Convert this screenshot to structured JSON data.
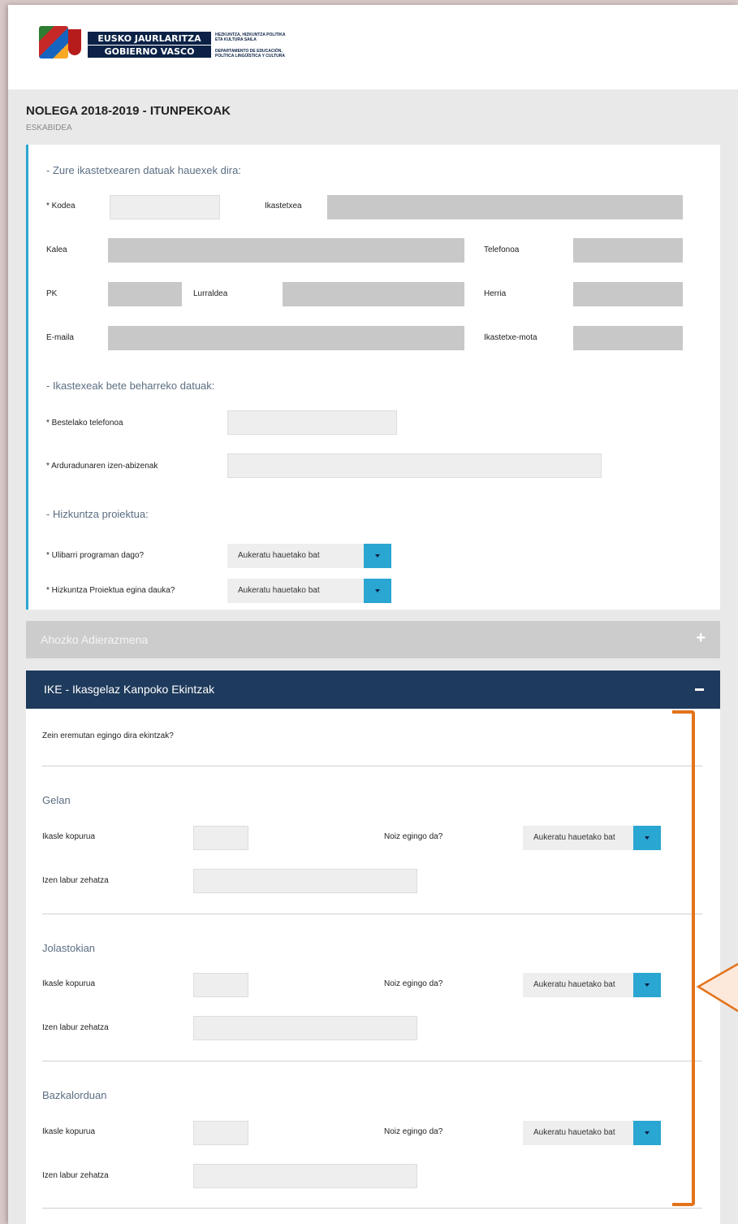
{
  "header": {
    "logo_line1": "EUSKO JAURLARITZA",
    "logo_line2": "GOBIERNO VASCO",
    "dept_eu_1": "HEZKUNTZA, HIZKUNTZA POLITIKA",
    "dept_eu_2": "ETA KULTURA SAILA",
    "dept_es_1": "DEPARTAMENTO DE EDUCACIÓN,",
    "dept_es_2": "POLÍTICA LINGÜÍSTICA Y CULTURA"
  },
  "page": {
    "title": "NOLEGA 2018-2019 - ITUNPEKOAK",
    "subtitle": "ESKABIDEA"
  },
  "school": {
    "heading": "- Zure ikastetxearen datuak hauexek dira:",
    "kodea_label": "* Kodea",
    "ikastetxea_label": "Ikastetxea",
    "kalea_label": "Kalea",
    "telefonoa_label": "Telefonoa",
    "pk_label": "PK",
    "lurraldea_label": "Lurraldea",
    "herria_label": "Herria",
    "emaila_label": "E-maila",
    "mota_label": "Ikastetxe-mota"
  },
  "fill": {
    "heading": "- Ikastexeak bete beharreko datuak:",
    "phone_label": "* Bestelako telefonoa",
    "resp_label": "* Arduradunaren izen-abizenak"
  },
  "lang": {
    "heading": "- Hizkuntza proiektua:",
    "ulibarri_label": "* Ulibarri programan dago?",
    "proiektua_label": "* Hizkuntza Proiektua egina dauka?",
    "select_placeholder": "Aukeratu hauetako bat"
  },
  "ahozko": {
    "title": "Ahozko Adierazmena"
  },
  "ike": {
    "title": "IKE - Ikasgelaz Kanpoko Ekintzak",
    "question": "Zein eremutan egingo dira ekintzak?",
    "sections": [
      {
        "name": "Gelan"
      },
      {
        "name": "Jolastokian"
      },
      {
        "name": "Bazkalorduan"
      }
    ],
    "count_label": "Ikasle kopurua",
    "when_label": "Noiz egingo da?",
    "name_label": "Izen labur zehatza",
    "select_placeholder": "Aukeratu hauetako bat"
  },
  "colors": {
    "accent_blue": "#2aa6d2",
    "navy": "#1e3a5c",
    "annotation_orange": "#e3731b"
  }
}
